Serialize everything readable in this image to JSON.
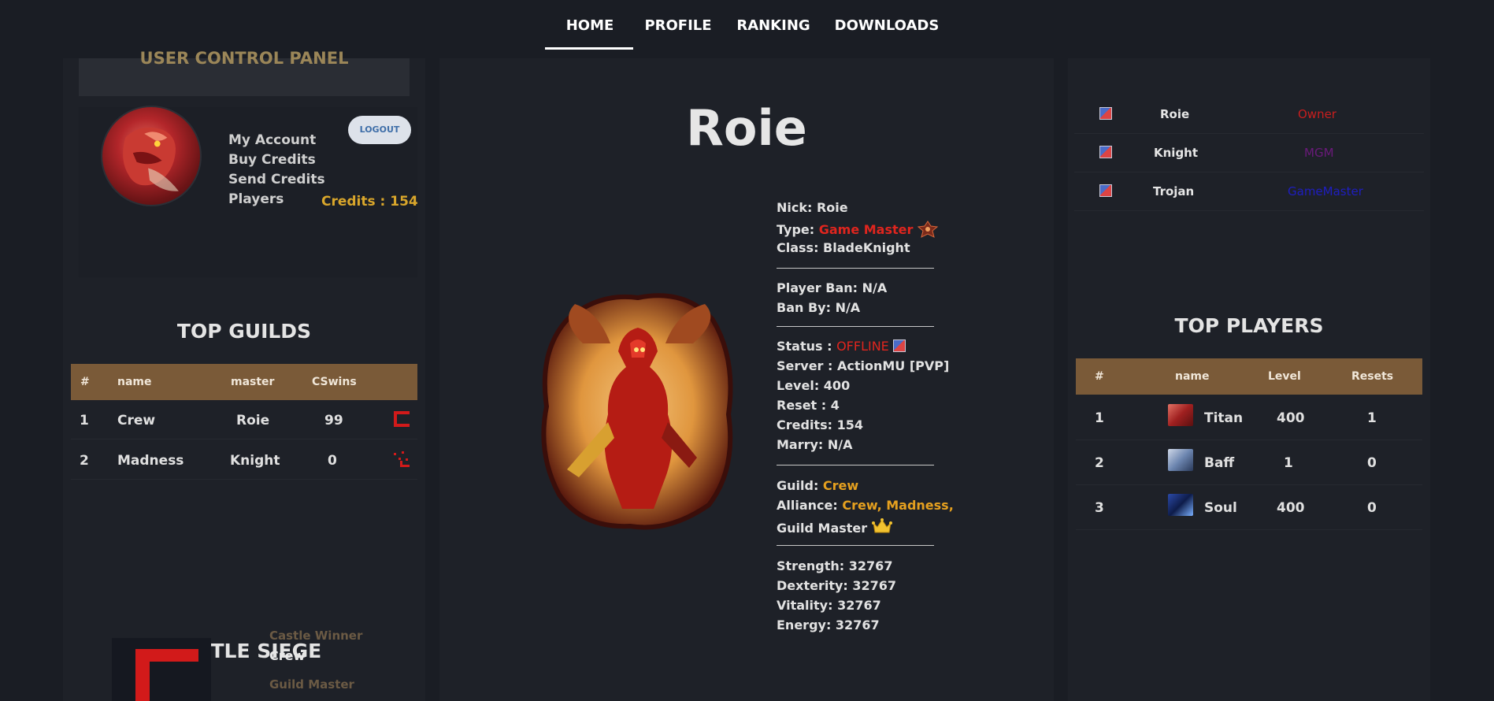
{
  "nav": {
    "items": [
      "HOME",
      "PROFILE",
      "RANKING",
      "DOWNLOADS"
    ],
    "active": "HOME"
  },
  "user_panel": {
    "title": "USER CONTROL PANEL",
    "links": [
      "My Account",
      "Buy Credits",
      "Send Credits",
      "Players"
    ],
    "logout_label": "LOGOUT",
    "credits_text": "Credits : 154"
  },
  "top_guilds": {
    "title": "TOP GUILDS",
    "columns": [
      "#",
      "name",
      "master",
      "CSwins"
    ],
    "rows": [
      {
        "rank": "1",
        "name": "Crew",
        "master": "Roie",
        "cswins": "99"
      },
      {
        "rank": "2",
        "name": "Madness",
        "master": "Knight",
        "cswins": "0"
      }
    ]
  },
  "castle_siege": {
    "title": "CASTLE SIEGE",
    "winner_label": "Castle Winner",
    "winner_value": "Crew",
    "master_label": "Guild Master"
  },
  "character": {
    "name": "Roie",
    "nick_label": "Nick:",
    "nick": "Roie",
    "type_label": "Type:",
    "type": "Game Master",
    "class_label": "Class:",
    "class": "BladeKnight",
    "player_ban_label": "Player Ban:",
    "player_ban": "N/A",
    "ban_by_label": "Ban By:",
    "ban_by": "N/A",
    "status_label": "Status :",
    "status": "OFFLINE",
    "server_label": "Server :",
    "server": "ActionMU [PVP]",
    "level_label": "Level:",
    "level": "400",
    "reset_label": "Reset :",
    "reset": "4",
    "credits_label": "Credits:",
    "credits": "154",
    "marry_label": "Marry:",
    "marry": "N/A",
    "guild_label": "Guild:",
    "guild": "Crew",
    "alliance_label": "Alliance:",
    "alliance": "Crew,  Madness,",
    "guild_role": "Guild Master",
    "strength_label": "Strength:",
    "strength": "32767",
    "dexterity_label": "Dexterity:",
    "dexterity": "32767",
    "vitality_label": "Vitality:",
    "vitality": "32767",
    "energy_label": "Energy:",
    "energy": "32767"
  },
  "staff_online": [
    {
      "name": "Roie",
      "role": "Owner",
      "role_color": "#c81e1e"
    },
    {
      "name": "Knight",
      "role": "MGM",
      "role_color": "#6a1a7a"
    },
    {
      "name": "Trojan",
      "role": "GameMaster",
      "role_color": "#1e1ec0"
    }
  ],
  "top_players": {
    "title": "TOP PLAYERS",
    "columns": [
      "#",
      "name",
      "Level",
      "Resets"
    ],
    "rows": [
      {
        "rank": "1",
        "name": "Titan",
        "level": "400",
        "resets": "1"
      },
      {
        "rank": "2",
        "name": "Baff",
        "level": "1",
        "resets": "0"
      },
      {
        "rank": "3",
        "name": "Soul",
        "level": "400",
        "resets": "0"
      }
    ]
  },
  "colors": {
    "background": "#1a1d24",
    "panel": "#1e2128",
    "table_header": "#7a5a38",
    "credits_gold": "#d9a62b",
    "offline_red": "#e0251e",
    "guild_orange": "#e5a01f"
  }
}
